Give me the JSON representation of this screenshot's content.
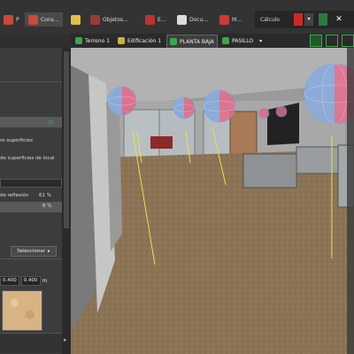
{
  "toolbar": {
    "tabs": [
      {
        "label": "P",
        "icon": "document-icon"
      },
      {
        "label": "Cons…",
        "icon": "building-icon"
      },
      {
        "label": "",
        "icon": "pen-icon"
      },
      {
        "label": "Objetos…",
        "icon": "objects-icon"
      },
      {
        "label": "E…",
        "icon": "blueprint-icon"
      },
      {
        "label": "Docu…",
        "icon": "docs-icon"
      },
      {
        "label": "M…",
        "icon": "book-icon"
      }
    ],
    "calc_label": "Cálculo"
  },
  "view_tabs": [
    "Terreno 1",
    "Edificación 1",
    "PLANTA BAJA",
    "PASILLO"
  ],
  "left_panel": {
    "surfaces_text": "re superficies",
    "local_surfaces_text": "de superficies de local",
    "reflection_label": "de reflexión",
    "reflection_value": "61 %",
    "second_value": "8 %",
    "select_button": "Seleccionar",
    "dim_a": "0.400",
    "dim_b": "0.400",
    "dim_unit": "m"
  },
  "colors": {
    "panel": "#3c3c3c",
    "toolbar": "#333333",
    "accent_green": "#3aa84a",
    "accent_red": "#cc2a2a",
    "floor": "#8b7355",
    "light_dome_red": "#e26a8a",
    "light_dome_blue": "#7ab8ea"
  }
}
